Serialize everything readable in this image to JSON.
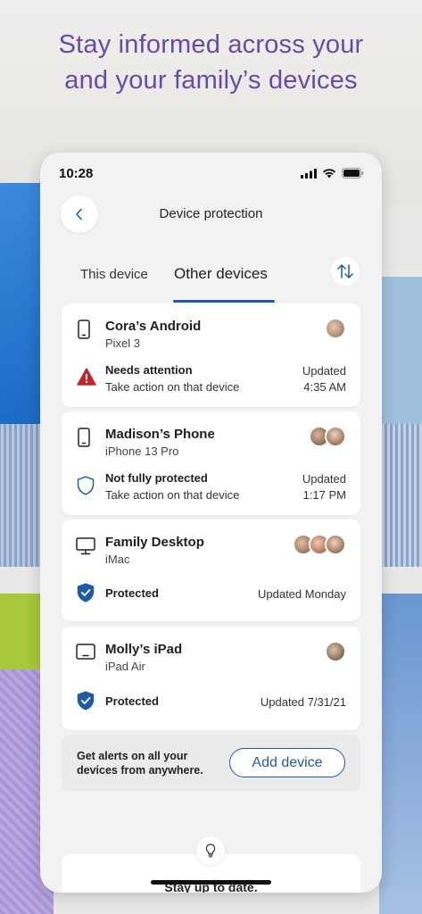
{
  "headline": {
    "line1": "Stay informed across your",
    "line2": "and your family’s devices"
  },
  "status_bar": {
    "time": "10:28",
    "icons": [
      "signal-icon",
      "wifi-icon",
      "battery-icon"
    ]
  },
  "header": {
    "back_icon": "chevron-left-icon",
    "title": "Device protection"
  },
  "tabs": [
    {
      "label": "This device",
      "active": false
    },
    {
      "label": "Other devices",
      "active": true
    }
  ],
  "sort_icon": "sort-arrows-icon",
  "devices": [
    {
      "name": "Cora’s Android",
      "model": "Pixel 3",
      "device_icon": "phone-icon",
      "avatars": 1,
      "status_icon": "warning-icon",
      "status_title": "Needs attention",
      "status_sub": "Take action on that device",
      "updated_line1": "Updated",
      "updated_line2": "4:35 AM"
    },
    {
      "name": "Madison’s Phone",
      "model": "iPhone 13 Pro",
      "device_icon": "phone-icon",
      "avatars": 2,
      "status_icon": "shield-outline-icon",
      "status_title": "Not fully protected",
      "status_sub": "Take action on that device",
      "updated_line1": "Updated",
      "updated_line2": "1:17 PM"
    },
    {
      "name": "Family Desktop",
      "model": "iMac",
      "device_icon": "desktop-icon",
      "avatars": 3,
      "status_icon": "shield-check-icon",
      "status_title": "Protected",
      "updated": "Updated Monday"
    },
    {
      "name": "Molly’s iPad",
      "model": "iPad Air",
      "device_icon": "tablet-icon",
      "avatars": 1,
      "status_icon": "shield-check-icon",
      "status_title": "Protected",
      "updated": "Updated 7/31/21"
    }
  ],
  "promo": {
    "text": "Get alerts on all your devices from anywhere.",
    "button": "Add device"
  },
  "tip": {
    "icon": "lightbulb-icon",
    "text": "Stay up to date."
  },
  "colors": {
    "headline": "#6b4aa5",
    "accent": "#1f5aa6",
    "warning": "#c0262d"
  }
}
